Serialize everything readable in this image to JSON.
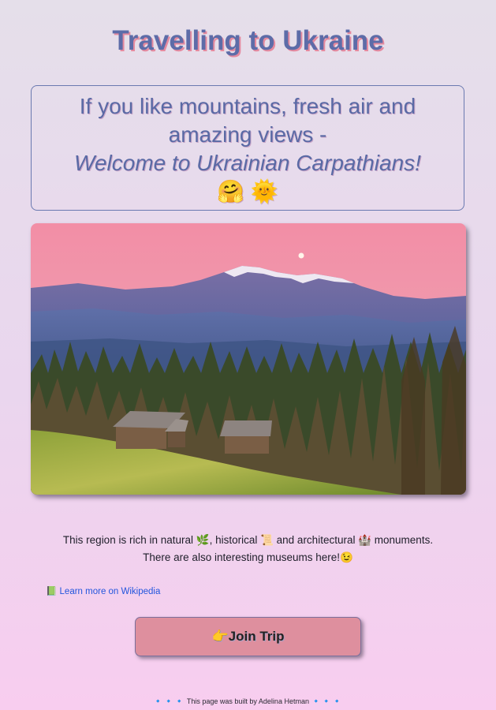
{
  "header": {
    "title": "Travelling to Ukraine"
  },
  "intro": {
    "line1": "If you like mountains, fresh air and",
    "line2": "amazing views -",
    "line3": "Welcome to Ukrainian Carpathians!",
    "emoji": "🤗 🌞"
  },
  "photo": {
    "description": "Carpathian mountains landscape",
    "icon": "landscape-photo"
  },
  "description": {
    "line1_a": "This region is rich in natural ",
    "line1_emoji1": "🌿",
    "line1_b": ", historical ",
    "line1_emoji2": "📜",
    "line1_c": " and architectural ",
    "line1_emoji3": "🏰",
    "line1_d": " monuments.",
    "line2": "There are also interesting museums here!",
    "line2_emoji": "😉"
  },
  "wiki_link": {
    "icon": "📗",
    "label": "Learn more on Wikipedia"
  },
  "join_button": {
    "icon": "👉",
    "label": "Join Trip"
  },
  "footer": {
    "left_marks": "🔹🔹🔹",
    "text": " This page was built by Adelina Hetman ",
    "right_marks": "🔹🔹🔹"
  },
  "colors": {
    "title": "#5d6ca8",
    "title_shadow": "#e58a9f",
    "button": "#de8f9e",
    "link": "#2255dd"
  }
}
